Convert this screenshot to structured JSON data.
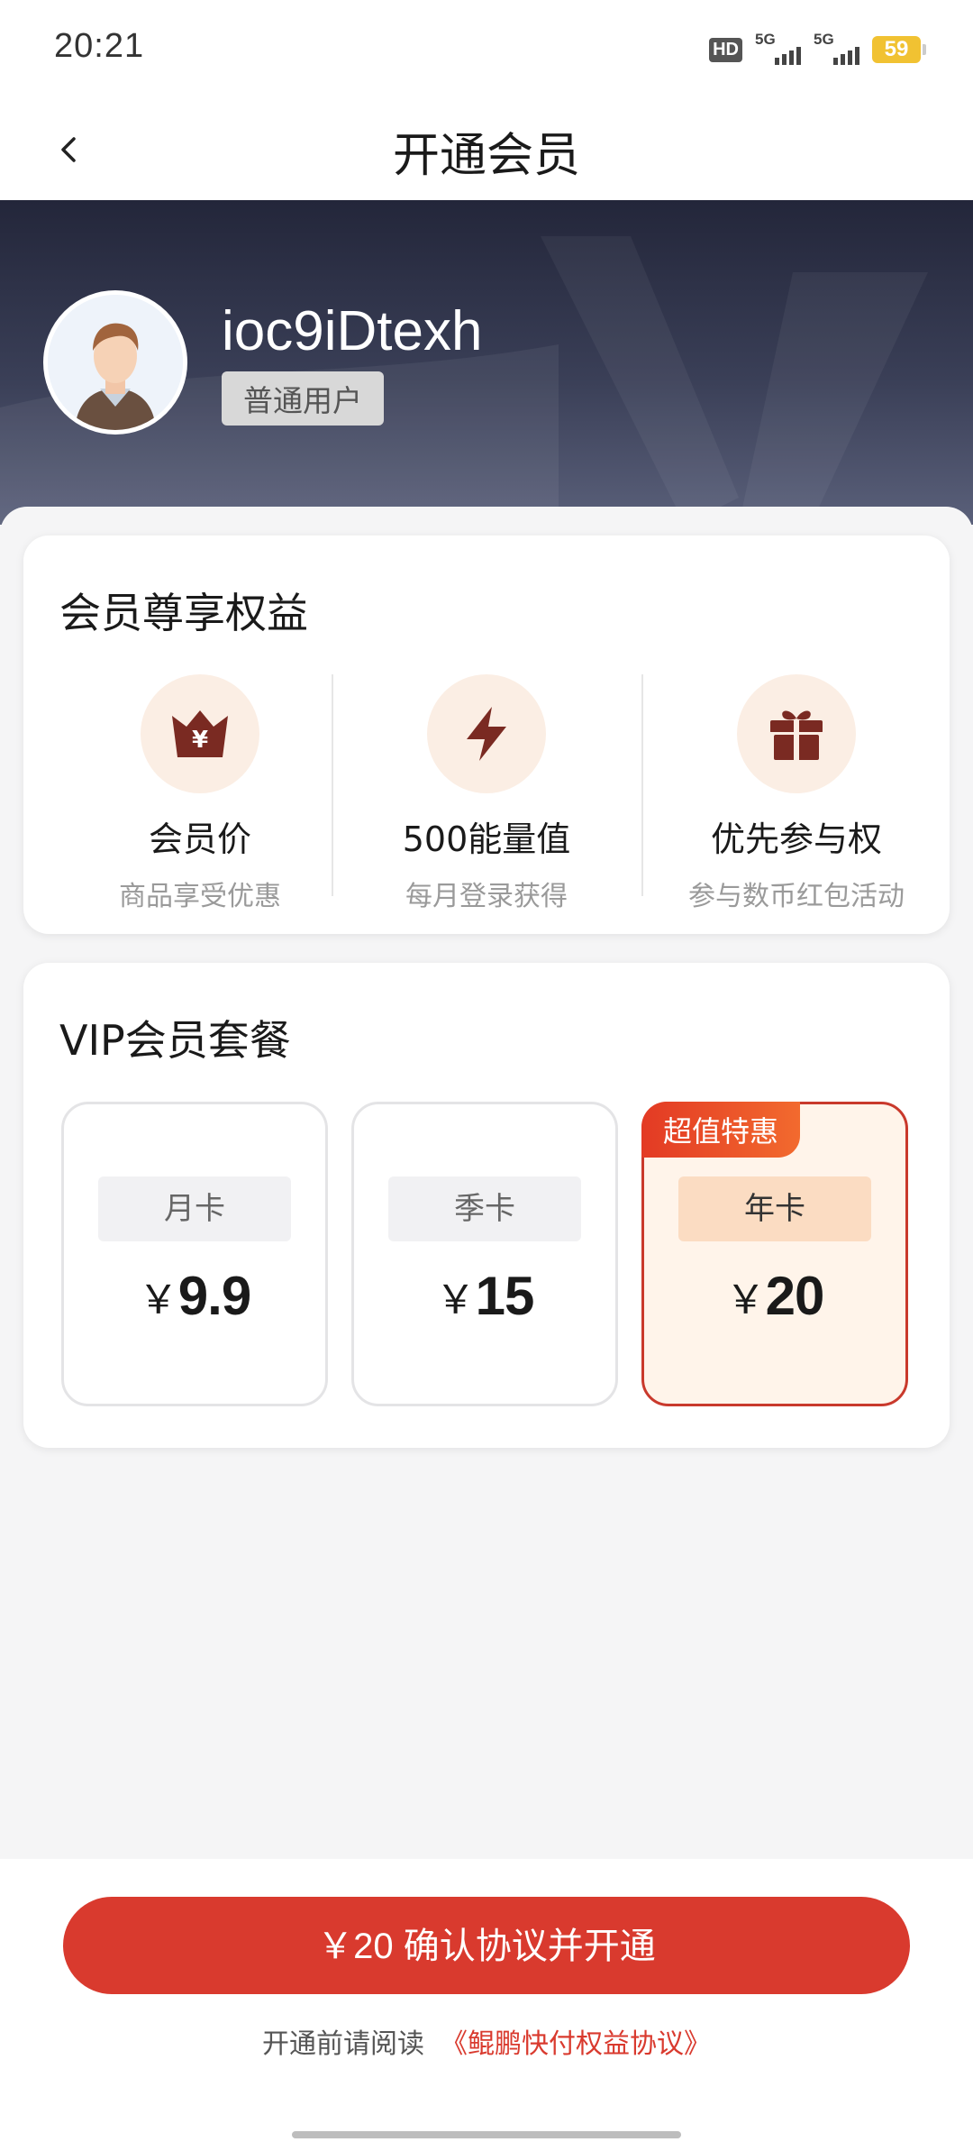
{
  "status_bar": {
    "time": "20:21",
    "hd_label": "HD",
    "signal1_label": "5G",
    "signal2_label": "5G",
    "battery_level": "59"
  },
  "nav": {
    "title": "开通会员"
  },
  "user": {
    "username": "ioc9iDtexh",
    "level_badge": "普通用户"
  },
  "benefits": {
    "title": "会员尊享权益",
    "items": [
      {
        "name": "会员价",
        "desc": "商品享受优惠",
        "icon": "crown-yen-icon"
      },
      {
        "name": "500能量值",
        "desc": "每月登录获得",
        "icon": "lightning-icon"
      },
      {
        "name": "优先参与权",
        "desc": "参与数币红包活动",
        "icon": "gift-icon"
      }
    ]
  },
  "plans": {
    "title": "VIP会员套餐",
    "currency": "￥",
    "items": [
      {
        "name": "月卡",
        "price": "9.9"
      },
      {
        "name": "季卡",
        "price": "15"
      },
      {
        "name": "年卡",
        "price": "20",
        "tag": "超值特惠",
        "selected": true
      }
    ]
  },
  "footer": {
    "confirm_label": "￥20 确认协议并开通",
    "agreement_prefix": "开通前请阅读",
    "agreement_link": "《鲲鹏快付权益协议》"
  },
  "colors": {
    "accent": "#d93a2e",
    "banner": "#2a2d42",
    "icon_bg": "#fbeee4",
    "icon_fg": "#7a2a22"
  }
}
